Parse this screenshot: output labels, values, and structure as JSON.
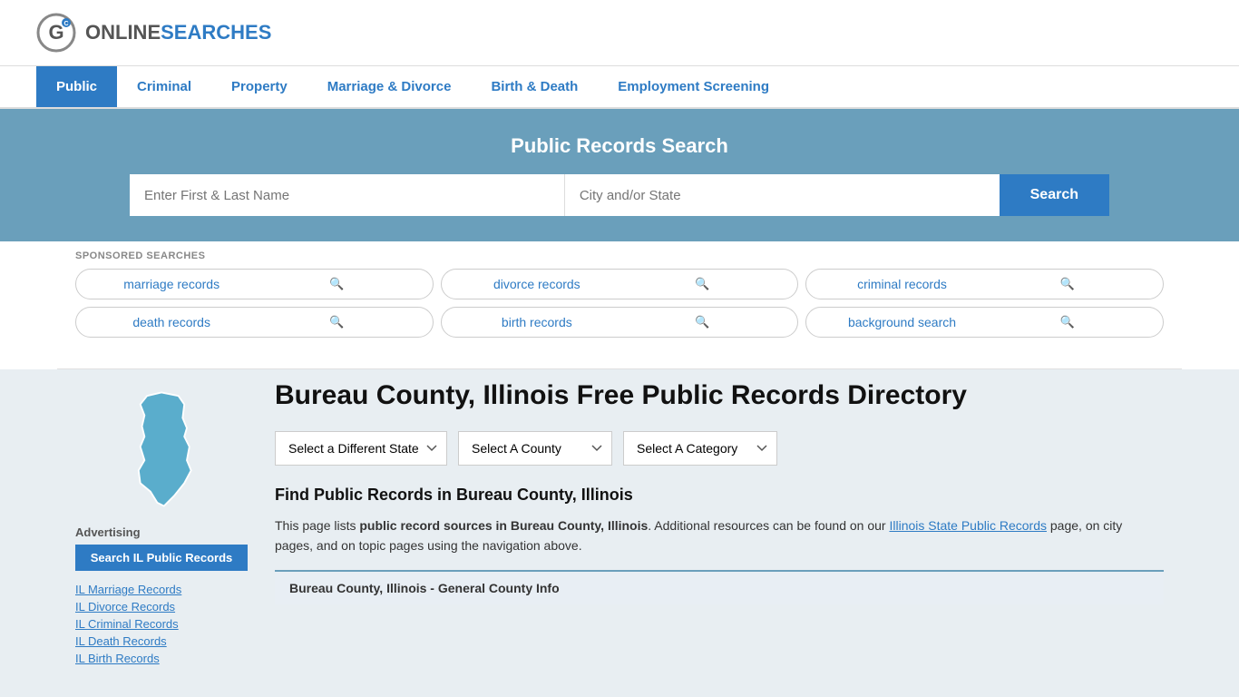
{
  "header": {
    "logo_online": "ONLINE",
    "logo_searches": "SEARCHES",
    "logo_alt": "OnlineSearches"
  },
  "nav": {
    "items": [
      {
        "label": "Public",
        "active": true
      },
      {
        "label": "Criminal",
        "active": false
      },
      {
        "label": "Property",
        "active": false
      },
      {
        "label": "Marriage & Divorce",
        "active": false
      },
      {
        "label": "Birth & Death",
        "active": false
      },
      {
        "label": "Employment Screening",
        "active": false
      }
    ]
  },
  "hero": {
    "title": "Public Records Search",
    "name_placeholder": "Enter First & Last Name",
    "location_placeholder": "City and/or State",
    "search_button": "Search"
  },
  "sponsored": {
    "label": "SPONSORED SEARCHES",
    "items": [
      "marriage records",
      "divorce records",
      "criminal records",
      "death records",
      "birth records",
      "background search"
    ]
  },
  "page_title": "Bureau County, Illinois Free Public Records Directory",
  "dropdowns": {
    "state": "Select a Different State",
    "county": "Select A County",
    "category": "Select A Category"
  },
  "section_heading": "Find Public Records in Bureau County, Illinois",
  "description_part1": "This page lists ",
  "description_bold1": "public record sources in Bureau County, Illinois",
  "description_part2": ". Additional resources can be found on our ",
  "description_link": "Illinois State Public Records",
  "description_part3": " page, on city pages, and on topic pages using the navigation above.",
  "info_bar": "Bureau County, Illinois - General County Info",
  "sidebar": {
    "ad_title": "Advertising",
    "ad_button": "Search IL Public Records",
    "links": [
      "IL Marriage Records",
      "IL Divorce Records",
      "IL Criminal Records",
      "IL Death Records",
      "IL Birth Records"
    ]
  }
}
